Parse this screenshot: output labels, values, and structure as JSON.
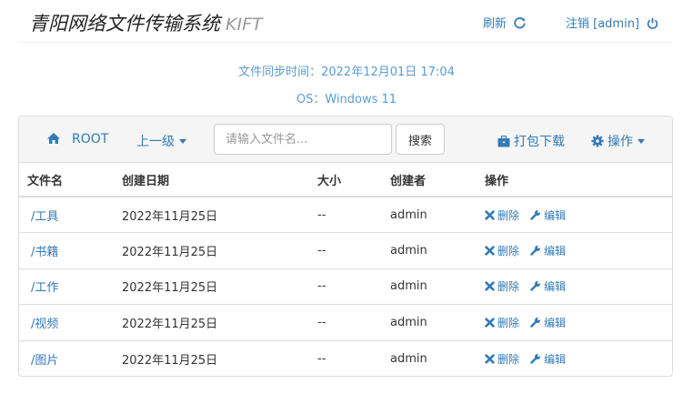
{
  "header": {
    "title": "青阳网络文件传输系统",
    "subtitle": "KIFT",
    "refresh_label": "刷新",
    "logout_label": "注销 [admin]"
  },
  "info": {
    "sync_time": "文件同步时间：2022年12月01日 17:04",
    "os": "OS：Windows 11"
  },
  "toolbar": {
    "root_label": "ROOT",
    "up_label": "上一级",
    "search_placeholder": "请输入文件名...",
    "search_label": "搜索",
    "pack_label": "打包下载",
    "ops_label": "操作"
  },
  "table": {
    "columns": [
      "文件名",
      "创建日期",
      "大小",
      "创建者",
      "操作"
    ],
    "rows": [
      {
        "name": "/工具",
        "date": "2022年11月25日",
        "size": "--",
        "owner": "admin"
      },
      {
        "name": "/书籍",
        "date": "2022年11月25日",
        "size": "--",
        "owner": "admin"
      },
      {
        "name": "/工作",
        "date": "2022年11月25日",
        "size": "--",
        "owner": "admin"
      },
      {
        "name": "/视频",
        "date": "2022年11月25日",
        "size": "--",
        "owner": "admin"
      },
      {
        "name": "/图片",
        "date": "2022年11月25日",
        "size": "--",
        "owner": "admin"
      }
    ],
    "delete_label": "删除",
    "edit_label": "编辑"
  },
  "colors": {
    "link": "#337ab7",
    "info": "#5b9bd5",
    "toolbar_bg": "#f5f5f5"
  },
  "icons": {
    "refresh": "refresh-icon",
    "logout": "power-icon",
    "root": "home-icon",
    "pack": "briefcase-icon",
    "ops": "gear-icon",
    "delete": "x-icon",
    "edit": "wrench-icon"
  }
}
